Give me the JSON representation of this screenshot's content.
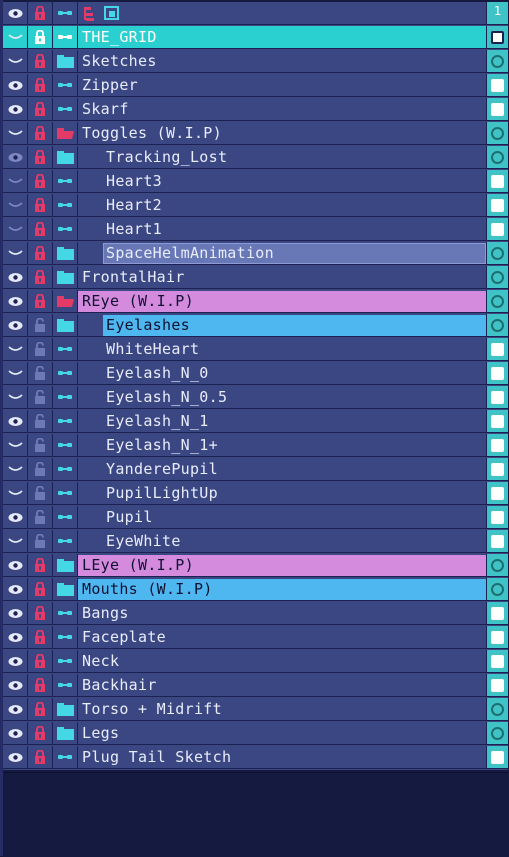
{
  "header": {
    "frame_number": "1"
  },
  "colors": {
    "row_bg": "#3b4783",
    "cel_column": "#40c3c6",
    "selected_layer": "#2ad0cf",
    "highlight_blue": "#4fb7f0",
    "highlight_pink": "#d48bde",
    "highlight_selection": "#6878b7",
    "lock_red": "#e23b68",
    "lock_gray": "#6d78b6",
    "group_cyan": "#44d7e4",
    "group_open_red": "#e23b68",
    "eye_white": "#e6e9f6"
  },
  "layers": [
    {
      "name": "THE_GRID",
      "type": "layer",
      "visibility": "hidden",
      "lock": "locked-white",
      "indent": false,
      "highlight": "selected",
      "cel": "filled"
    },
    {
      "name": "Sketches",
      "type": "group",
      "visibility": "hidden",
      "lock": "locked",
      "indent": false,
      "highlight": "",
      "cel": "hollow"
    },
    {
      "name": "Zipper",
      "type": "layer",
      "visibility": "visible",
      "lock": "locked",
      "indent": false,
      "highlight": "",
      "cel": "filled"
    },
    {
      "name": "Skarf",
      "type": "layer",
      "visibility": "visible",
      "lock": "locked",
      "indent": false,
      "highlight": "",
      "cel": "filled"
    },
    {
      "name": "Toggles (W.I.P)",
      "type": "group-open",
      "visibility": "hidden",
      "lock": "locked",
      "indent": false,
      "highlight": "",
      "cel": "hollow"
    },
    {
      "name": "Tracking_Lost",
      "type": "group",
      "visibility": "visible-dim",
      "lock": "locked",
      "indent": true,
      "highlight": "",
      "cel": "hollow"
    },
    {
      "name": "Heart3",
      "type": "layer",
      "visibility": "hidden-dim",
      "lock": "locked",
      "indent": true,
      "highlight": "",
      "cel": "filled"
    },
    {
      "name": "Heart2",
      "type": "layer",
      "visibility": "hidden-dim",
      "lock": "locked",
      "indent": true,
      "highlight": "",
      "cel": "filled"
    },
    {
      "name": "Heart1",
      "type": "layer",
      "visibility": "hidden-dim",
      "lock": "locked",
      "indent": true,
      "highlight": "",
      "cel": "filled"
    },
    {
      "name": "SpaceHelmAnimation",
      "type": "group",
      "visibility": "hidden",
      "lock": "locked",
      "indent": true,
      "highlight": "selection",
      "cel": "hollow"
    },
    {
      "name": "FrontalHair",
      "type": "group",
      "visibility": "visible",
      "lock": "locked",
      "indent": false,
      "highlight": "",
      "cel": "hollow"
    },
    {
      "name": "REye (W.I.P)",
      "type": "group-open",
      "visibility": "visible",
      "lock": "locked",
      "indent": false,
      "highlight": "pink",
      "cel": "hollow"
    },
    {
      "name": "Eyelashes",
      "type": "group",
      "visibility": "visible",
      "lock": "unlocked",
      "indent": true,
      "highlight": "blue",
      "cel": "hollow"
    },
    {
      "name": "WhiteHeart",
      "type": "layer",
      "visibility": "hidden",
      "lock": "unlocked",
      "indent": true,
      "highlight": "",
      "cel": "filled"
    },
    {
      "name": "Eyelash_N_0",
      "type": "layer",
      "visibility": "hidden",
      "lock": "unlocked",
      "indent": true,
      "highlight": "",
      "cel": "filled"
    },
    {
      "name": "Eyelash_N_0.5",
      "type": "layer",
      "visibility": "hidden",
      "lock": "unlocked",
      "indent": true,
      "highlight": "",
      "cel": "filled"
    },
    {
      "name": "Eyelash_N_1",
      "type": "layer",
      "visibility": "visible",
      "lock": "unlocked",
      "indent": true,
      "highlight": "",
      "cel": "filled"
    },
    {
      "name": "Eyelash_N_1+",
      "type": "layer",
      "visibility": "hidden",
      "lock": "unlocked",
      "indent": true,
      "highlight": "",
      "cel": "filled"
    },
    {
      "name": "YanderePupil",
      "type": "layer",
      "visibility": "hidden",
      "lock": "unlocked",
      "indent": true,
      "highlight": "",
      "cel": "filled"
    },
    {
      "name": "PupilLightUp",
      "type": "layer",
      "visibility": "hidden",
      "lock": "unlocked",
      "indent": true,
      "highlight": "",
      "cel": "filled"
    },
    {
      "name": "Pupil",
      "type": "layer",
      "visibility": "visible",
      "lock": "unlocked",
      "indent": true,
      "highlight": "",
      "cel": "filled"
    },
    {
      "name": "EyeWhite",
      "type": "layer",
      "visibility": "hidden",
      "lock": "unlocked",
      "indent": true,
      "highlight": "",
      "cel": "filled"
    },
    {
      "name": "LEye (W.I.P)",
      "type": "group",
      "visibility": "visible",
      "lock": "locked",
      "indent": false,
      "highlight": "pink",
      "cel": "hollow"
    },
    {
      "name": "Mouths (W.I.P)",
      "type": "group",
      "visibility": "visible",
      "lock": "locked",
      "indent": false,
      "highlight": "blue",
      "cel": "hollow"
    },
    {
      "name": "Bangs",
      "type": "layer",
      "visibility": "visible",
      "lock": "locked",
      "indent": false,
      "highlight": "",
      "cel": "filled"
    },
    {
      "name": "Faceplate",
      "type": "layer",
      "visibility": "visible",
      "lock": "locked",
      "indent": false,
      "highlight": "",
      "cel": "filled"
    },
    {
      "name": "Neck",
      "type": "layer",
      "visibility": "visible",
      "lock": "locked",
      "indent": false,
      "highlight": "",
      "cel": "filled"
    },
    {
      "name": "Backhair",
      "type": "layer",
      "visibility": "visible",
      "lock": "locked",
      "indent": false,
      "highlight": "",
      "cel": "filled"
    },
    {
      "name": "Torso + Midrift",
      "type": "group",
      "visibility": "visible",
      "lock": "locked",
      "indent": false,
      "highlight": "",
      "cel": "hollow"
    },
    {
      "name": "Legs",
      "type": "group",
      "visibility": "visible",
      "lock": "locked",
      "indent": false,
      "highlight": "",
      "cel": "hollow"
    },
    {
      "name": "Plug Tail Sketch",
      "type": "layer",
      "visibility": "visible",
      "lock": "locked",
      "indent": false,
      "highlight": "",
      "cel": "filled"
    }
  ]
}
